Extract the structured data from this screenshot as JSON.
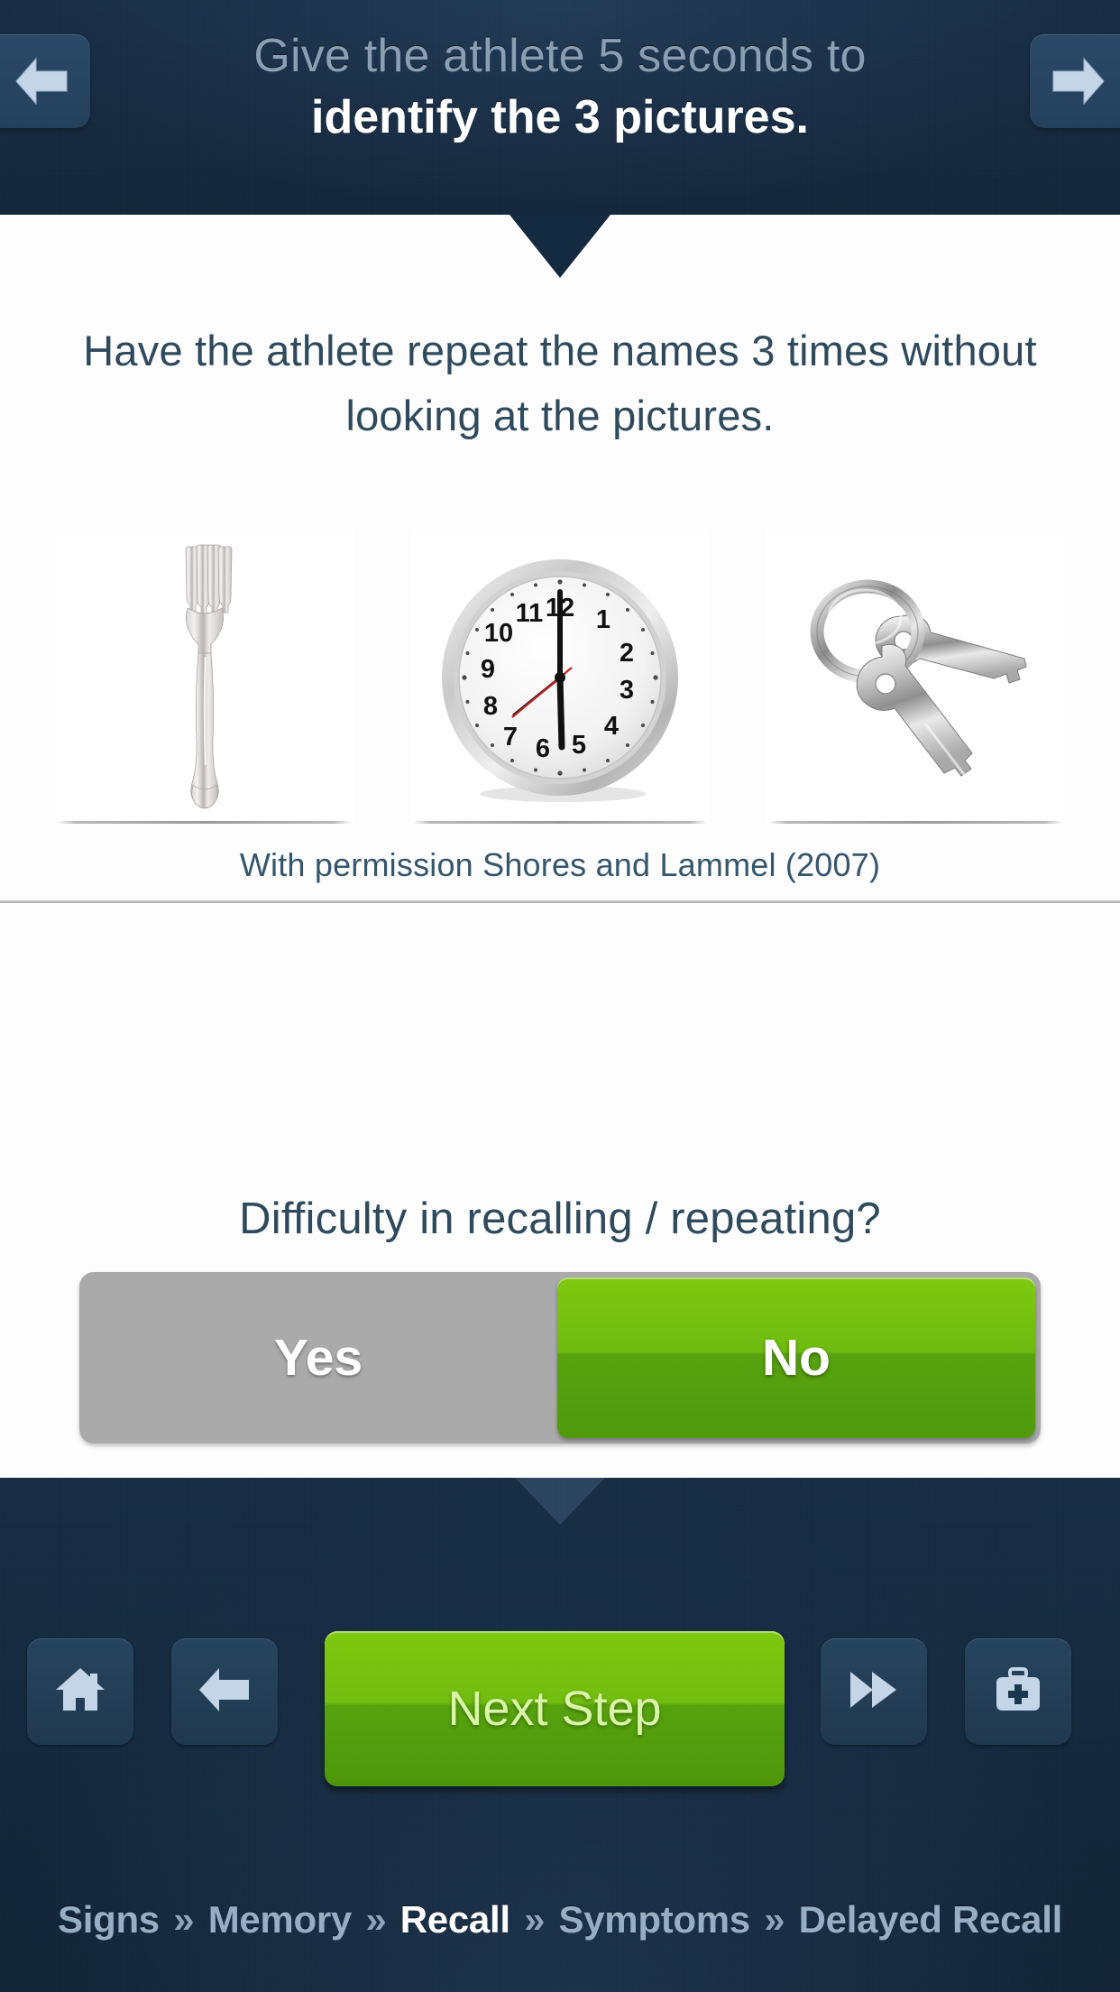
{
  "header": {
    "line1": "Give the athlete 5 seconds to",
    "line2": "identify the 3 pictures.",
    "prev_icon": "arrow-left-icon",
    "next_icon": "arrow-right-icon"
  },
  "main": {
    "instruction": "Have the athlete repeat the names 3 times without looking at the pictures.",
    "pictures": [
      {
        "name": "fork",
        "alt": "fork"
      },
      {
        "name": "clock",
        "alt": "clock"
      },
      {
        "name": "keys",
        "alt": "keys"
      }
    ],
    "attribution": "With permission Shores and Lammel (2007)",
    "question": "Difficulty in recalling / repeating?",
    "toggle": {
      "yes_label": "Yes",
      "no_label": "No",
      "selected": "No"
    }
  },
  "footer": {
    "home_icon": "home-icon",
    "back_icon": "arrow-left-icon",
    "next_step_label": "Next Step",
    "fast_forward_icon": "fast-forward-icon",
    "medkit_icon": "medical-kit-icon",
    "breadcrumb": [
      {
        "label": "Signs",
        "active": false
      },
      {
        "label": "Memory",
        "active": false
      },
      {
        "label": "Recall",
        "active": true
      },
      {
        "label": "Symptoms",
        "active": false
      },
      {
        "label": "Delayed Recall",
        "active": false
      }
    ],
    "breadcrumb_separator": "»"
  },
  "colors": {
    "header_bg": "#152b43",
    "body_bg": "#fdfdfd",
    "text_dark": "#2f4a5c",
    "accent_green": "#72bd0f",
    "toggle_track": "#aaaaaa",
    "breadcrumb_inactive": "#97aec4",
    "breadcrumb_active": "#ffffff"
  },
  "chart_data": null
}
